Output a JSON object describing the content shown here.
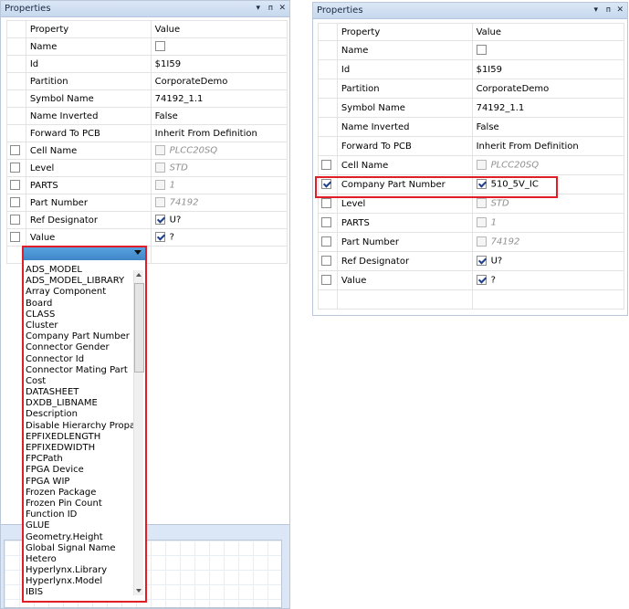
{
  "left_panel": {
    "title": "Properties",
    "ctrls": [
      "▾",
      "ᴨ",
      "✕"
    ],
    "header": {
      "property": "Property",
      "value": "Value"
    },
    "rows": [
      {
        "property": "Name",
        "value": "",
        "row_check": null,
        "value_check": false,
        "dim": false
      },
      {
        "property": "Id",
        "value": "$1I59",
        "row_check": null,
        "value_check": null,
        "dim": false
      },
      {
        "property": "Partition",
        "value": "CorporateDemo",
        "row_check": null,
        "value_check": null,
        "dim": false
      },
      {
        "property": "Symbol Name",
        "value": "74192_1.1",
        "row_check": null,
        "value_check": null,
        "dim": false
      },
      {
        "property": "Name Inverted",
        "value": "False",
        "row_check": null,
        "value_check": null,
        "dim": false
      },
      {
        "property": "Forward To PCB",
        "value": "Inherit From Definition",
        "row_check": null,
        "value_check": null,
        "dim": false
      },
      {
        "property": "Cell Name",
        "value": "PLCC20SQ",
        "row_check": false,
        "value_check": false,
        "dim": true
      },
      {
        "property": "Level",
        "value": "STD",
        "row_check": false,
        "value_check": false,
        "dim": true
      },
      {
        "property": "PARTS",
        "value": "1",
        "row_check": false,
        "value_check": false,
        "dim": true
      },
      {
        "property": "Part Number",
        "value": "74192",
        "row_check": false,
        "value_check": false,
        "dim": true
      },
      {
        "property": "Ref Designator",
        "value": "U?",
        "row_check": false,
        "value_check": true,
        "dim": false
      },
      {
        "property": "Value",
        "value": "?",
        "row_check": false,
        "value_check": true,
        "dim": false
      }
    ],
    "dropdown_items": [
      "ADS_MODEL",
      "ADS_MODEL_LIBRARY",
      "Array Component",
      "Board",
      "CLASS",
      "Cluster",
      "Company Part Number",
      "Connector Gender",
      "Connector Id",
      "Connector Mating Part",
      "Cost",
      "DATASHEET",
      "DXDB_LIBNAME",
      "Description",
      "Disable Hierarchy Propag",
      "EPFIXEDLENGTH",
      "EPFIXEDWIDTH",
      "FPCPath",
      "FPGA Device",
      "FPGA WIP",
      "Frozen Package",
      "Frozen Pin Count",
      "Function ID",
      "GLUE",
      "Geometry.Height",
      "Global Signal Name",
      "Hetero",
      "Hyperlynx.Library",
      "Hyperlynx.Model",
      "IBIS"
    ]
  },
  "right_panel": {
    "title": "Properties",
    "ctrls": [
      "▾",
      "ᴨ",
      "✕"
    ],
    "header": {
      "property": "Property",
      "value": "Value"
    },
    "rows": [
      {
        "property": "Name",
        "value": "",
        "row_check": null,
        "value_check": false,
        "dim": false
      },
      {
        "property": "Id",
        "value": "$1I59",
        "row_check": null,
        "value_check": null,
        "dim": false
      },
      {
        "property": "Partition",
        "value": "CorporateDemo",
        "row_check": null,
        "value_check": null,
        "dim": false
      },
      {
        "property": "Symbol Name",
        "value": "74192_1.1",
        "row_check": null,
        "value_check": null,
        "dim": false
      },
      {
        "property": "Name Inverted",
        "value": "False",
        "row_check": null,
        "value_check": null,
        "dim": false
      },
      {
        "property": "Forward To PCB",
        "value": "Inherit From Definition",
        "row_check": null,
        "value_check": null,
        "dim": false
      },
      {
        "property": "Cell Name",
        "value": "PLCC20SQ",
        "row_check": false,
        "value_check": false,
        "dim": true
      },
      {
        "property": "Company Part Number",
        "value": "510_5V_IC",
        "row_check": true,
        "value_check": true,
        "dim": false
      },
      {
        "property": "Level",
        "value": "STD",
        "row_check": false,
        "value_check": false,
        "dim": true
      },
      {
        "property": "PARTS",
        "value": "1",
        "row_check": false,
        "value_check": false,
        "dim": true
      },
      {
        "property": "Part Number",
        "value": "74192",
        "row_check": false,
        "value_check": false,
        "dim": true
      },
      {
        "property": "Ref Designator",
        "value": "U?",
        "row_check": false,
        "value_check": true,
        "dim": false
      },
      {
        "property": "Value",
        "value": "?",
        "row_check": false,
        "value_check": true,
        "dim": false
      }
    ]
  },
  "colors": {
    "highlight": "#e01e25",
    "titlebar": "#c7d8ee",
    "combo": "#3f86c8"
  }
}
